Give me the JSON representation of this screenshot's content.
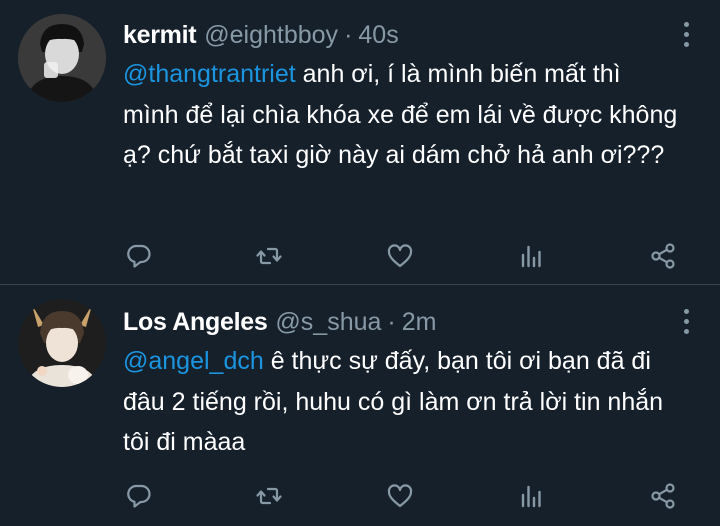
{
  "colors": {
    "background": "#15202b",
    "divider": "#38444d",
    "muted": "#8899a6",
    "mention": "#1b95e0",
    "text": "#ffffff"
  },
  "tweets": [
    {
      "name": "kermit",
      "handle": "@eightbboy",
      "separator": "·",
      "time": "40s",
      "mention": "@thangtrantriet",
      "text": " anh ơi, í là mình biến mất thì mình để lại chìa khóa xe để em lái về được không ạ? chứ bắt taxi giờ này ai dám chở hả anh ơi???",
      "avatar_icon": "user-avatar"
    },
    {
      "name": "Los Angeles",
      "handle": "@s_shua",
      "separator": "·",
      "time": "2m",
      "mention": "@angel_dch",
      "text": " ê thực sự đấy, bạn tôi ơi bạn đã đi đâu 2 tiếng rồi, huhu có gì làm ơn trả lời tin nhắn tôi đi màaa",
      "avatar_icon": "user-avatar"
    }
  ],
  "actions": [
    "reply-icon",
    "retweet-icon",
    "like-icon",
    "analytics-icon",
    "share-icon"
  ]
}
